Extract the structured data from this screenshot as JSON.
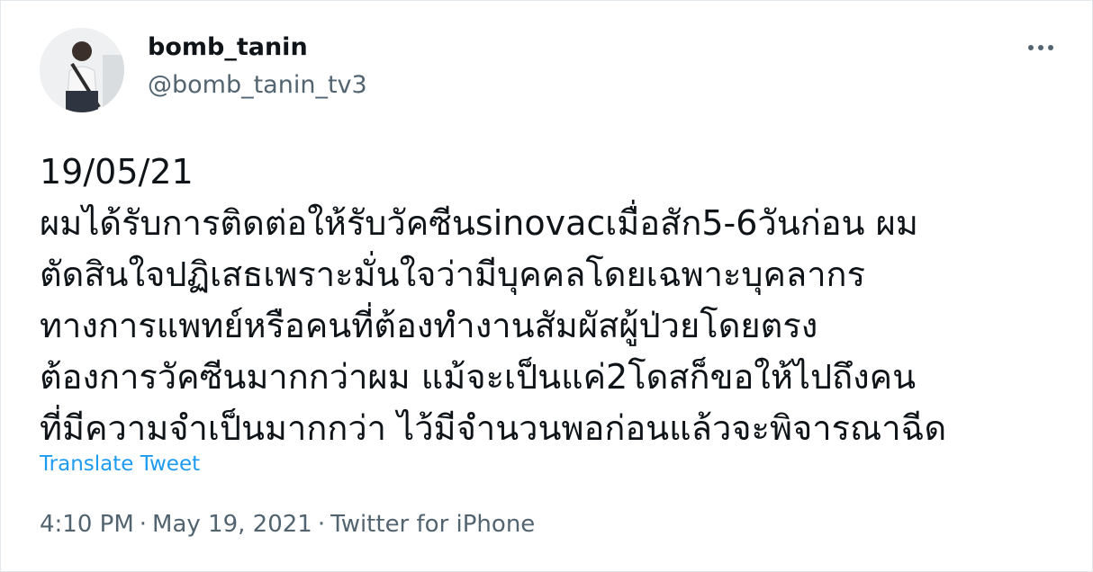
{
  "tweet": {
    "author": {
      "display_name": "bomb_tanin",
      "handle": "@bomb_tanin_tv3"
    },
    "menu_icon": "more-horizontal-icon",
    "text_lines": [
      "19/05/21",
      "ผมได้รับการติดต่อให้รับวัคซีนsinovacเมื่อสัก5-6วันก่อน ผม",
      "ตัดสินใจปฏิเสธเพราะมั่นใจว่ามีบุคคลโดยเฉพาะบุคลากร",
      "ทางการแพทย์หรือคนที่ต้องทำงานสัมผัสผู้ป่วยโดยตรง",
      "ต้องการวัคซีนมากกว่าผม แม้จะเป็นแค่2โดสก็ขอให้ไปถึงคน",
      "ที่มีความจำเป็นมากกว่า ไว้มีจำนวนพอก่อนแล้วจะพิจารณาฉีด"
    ],
    "translate_label": "Translate Tweet",
    "time": "4:10 PM",
    "date": "May 19, 2021",
    "source": "Twitter for iPhone",
    "separator": "·"
  },
  "colors": {
    "text": "#0f1419",
    "secondary": "#536471",
    "link": "#1d9bf0",
    "border": "#e3e8ec"
  }
}
